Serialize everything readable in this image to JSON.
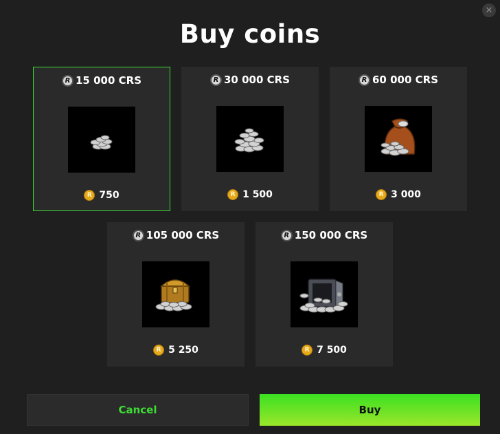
{
  "dialog": {
    "title": "Buy coins",
    "close_label": "✕"
  },
  "packages": [
    {
      "amount": "15 000 CRS",
      "price": "750",
      "selected": true,
      "image": "small-coin-pile"
    },
    {
      "amount": "30 000 CRS",
      "price": "1 500",
      "selected": false,
      "image": "medium-coin-pile"
    },
    {
      "amount": "60 000 CRS",
      "price": "3 000",
      "selected": false,
      "image": "coin-sack"
    },
    {
      "amount": "105 000 CRS",
      "price": "5 250",
      "selected": false,
      "image": "treasure-chest"
    },
    {
      "amount": "150 000 CRS",
      "price": "7 500",
      "selected": false,
      "image": "open-safe"
    }
  ],
  "icons": {
    "crs_letter": "R",
    "gold_letter": "R"
  },
  "colors": {
    "background": "#1f1f1f",
    "card": "#2a2a2a",
    "selected_border": "#3ddc33",
    "accent_green": "#3ddc33",
    "gold": "#e5a91a"
  },
  "actions": {
    "cancel_label": "Cancel",
    "buy_label": "Buy"
  }
}
